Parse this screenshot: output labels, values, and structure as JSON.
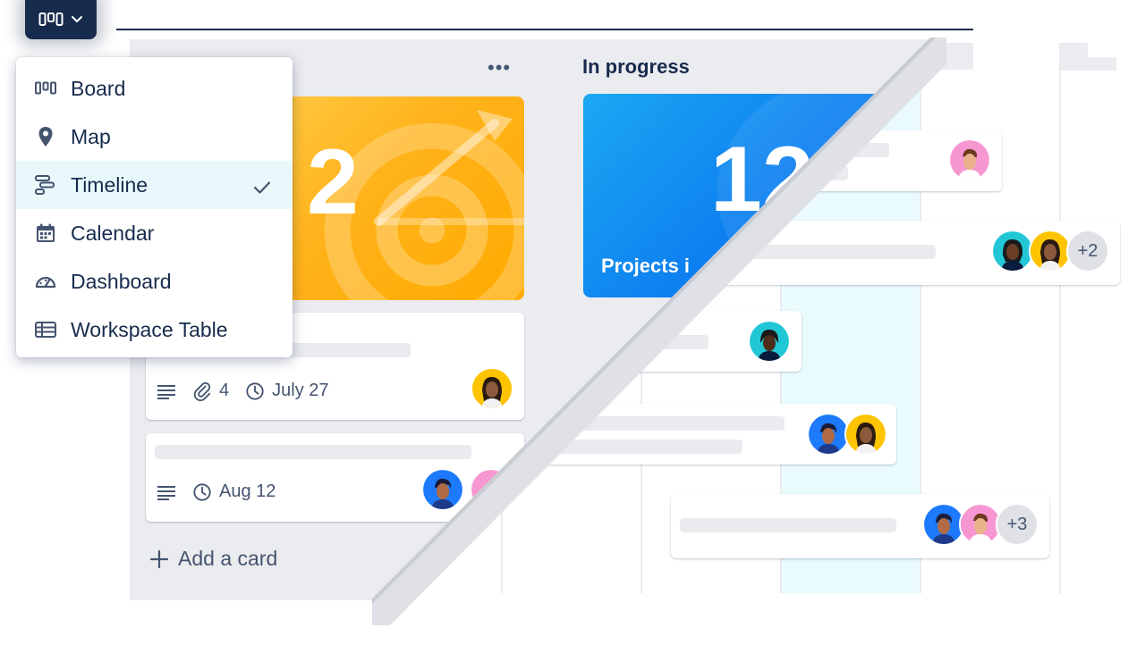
{
  "view_switcher": {
    "icon": "board-icon",
    "menu": [
      {
        "label": "Board",
        "icon": "board-icon"
      },
      {
        "label": "Map",
        "icon": "map-pin-icon"
      },
      {
        "label": "Timeline",
        "icon": "timeline-icon",
        "selected": true
      },
      {
        "label": "Calendar",
        "icon": "calendar-icon"
      },
      {
        "label": "Dashboard",
        "icon": "dashboard-icon"
      },
      {
        "label": "Workspace Table",
        "icon": "table-icon"
      }
    ]
  },
  "board": {
    "column_menu_label": "•••",
    "in_progress_title": "In progress",
    "cover_yellow_number": "2",
    "cover_blue_number": "12",
    "cover_blue_caption": "Projects i",
    "card1": {
      "attachments": "4",
      "date": "July 27"
    },
    "card2": {
      "date": "Aug 12"
    },
    "add_card_label": "Add a card"
  },
  "timeline": {
    "bar2_more": "+2",
    "bar5_more": "+3"
  },
  "colors": {
    "navy": "#172b4d",
    "board_bg": "#ebecf0",
    "today_highlight": "#e9fbfd",
    "selected_item_bg": "#e9f9fb",
    "accent_blue": "#0c66e4",
    "cover_yellow": "#ffb21a",
    "cover_blue": "#0c7cf0"
  }
}
